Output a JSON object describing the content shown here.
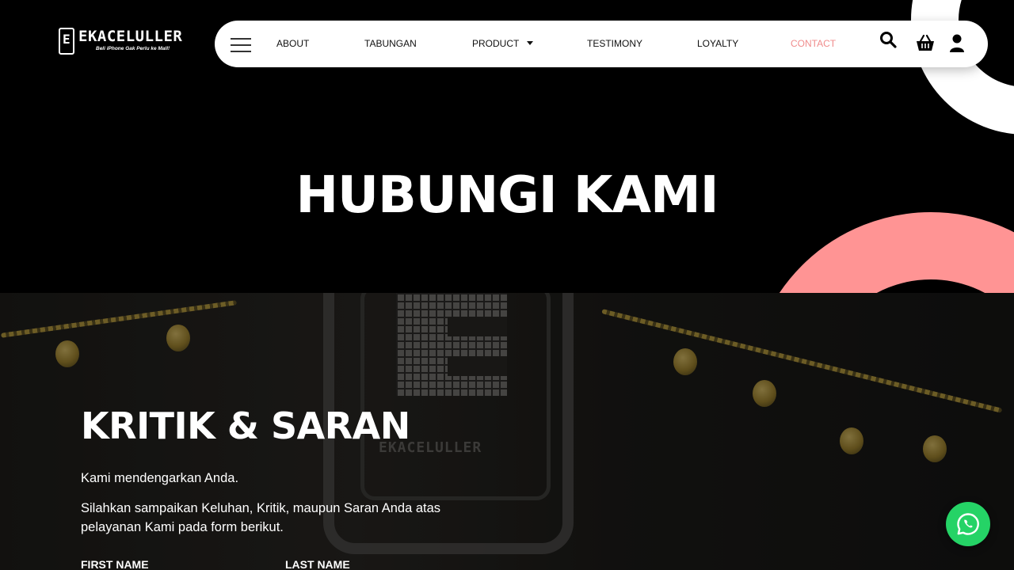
{
  "logo": {
    "wordmark": "EKACELULLER",
    "tagline": "Beli iPhone Gak Perlu ke Mall!"
  },
  "nav": {
    "items": [
      {
        "label": "ABOUT"
      },
      {
        "label": "TABUNGAN"
      },
      {
        "label": "PRODUCT"
      },
      {
        "label": "TESTIMONY"
      },
      {
        "label": "LOYALTY"
      },
      {
        "label": "CONTACT"
      }
    ],
    "active": "CONTACT",
    "icons": [
      "menu-icon",
      "search-icon",
      "basket-icon",
      "user-icon"
    ]
  },
  "hero": {
    "title": "HUBUNGI KAMI"
  },
  "feedback": {
    "title": "KRITIK & SARAN",
    "intro": "Kami mendengarkan Anda.",
    "description": "Silahkan sampaikan Keluhan, Kritik, maupun Saran Anda atas pelayanan Kami pada form berikut.",
    "first_name_label": "FIRST NAME",
    "last_name_label": "LAST NAME"
  },
  "background_sign_text": "EKACELULLER",
  "floating": {
    "icon": "whatsapp-icon"
  },
  "colors": {
    "accent_pink": "#ff9494",
    "active_link": "#f08c8c",
    "whatsapp_green": "#25d366",
    "hero_bg": "#000000"
  }
}
